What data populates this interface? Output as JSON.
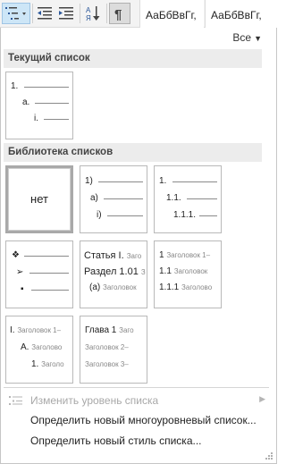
{
  "ribbon": {
    "style_tiles": [
      "АаБбВвГг,",
      "АаБбВвГг,"
    ]
  },
  "gallery": {
    "all_button": "Все",
    "current_header": "Текущий список",
    "library_header": "Библиотека списков",
    "current_tile": {
      "levels": [
        "1.",
        "a.",
        "i."
      ]
    },
    "library_tiles": [
      {
        "kind": "none",
        "label": "нет"
      },
      {
        "kind": "numbered",
        "levels": [
          "1)",
          "a)",
          "i)"
        ]
      },
      {
        "kind": "numbered",
        "levels": [
          "1.",
          "1.1.",
          "1.1.1."
        ]
      },
      {
        "kind": "bullets",
        "levels": [
          "❖",
          "➢",
          "▪"
        ]
      },
      {
        "kind": "headings",
        "levels": [
          {
            "num": "Статья I.",
            "text": "Заго"
          },
          {
            "num": "Раздел 1.01",
            "text": "З"
          },
          {
            "num": "(a)",
            "text": "Заголовок"
          }
        ]
      },
      {
        "kind": "headings",
        "levels": [
          {
            "num": "1",
            "text": "Заголовок 1–"
          },
          {
            "num": "1.1",
            "text": "Заголовок"
          },
          {
            "num": "1.1.1",
            "text": "Заголово"
          }
        ]
      },
      {
        "kind": "headings",
        "levels": [
          {
            "num": "I.",
            "text": "Заголовок 1–"
          },
          {
            "num": "A.",
            "text": "Заголово"
          },
          {
            "num": "1.",
            "text": "Заголо"
          }
        ]
      },
      {
        "kind": "headings",
        "levels": [
          {
            "num": "Глава 1",
            "text": "Заго"
          },
          {
            "num": "",
            "text": "Заголовок 2–"
          },
          {
            "num": "",
            "text": "Заголовок 3–"
          }
        ]
      }
    ]
  },
  "menu": {
    "change_level": "Изменить уровень списка",
    "define_multilevel": "Определить новый многоуровневый список...",
    "define_style": "Определить новый стиль списка..."
  },
  "colors": {
    "section_bg": "#ececec",
    "selected_border": "#a9a9a9",
    "ribbon_active": "#cde6f7"
  }
}
